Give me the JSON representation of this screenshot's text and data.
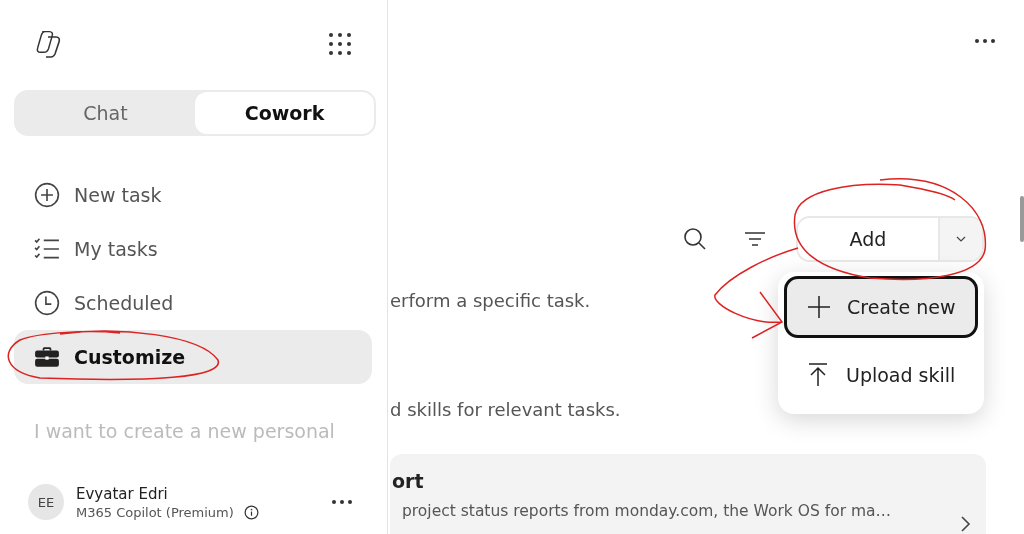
{
  "sidebar": {
    "tabs": [
      {
        "label": "Chat",
        "selected": false
      },
      {
        "label": "Cowork",
        "selected": true
      }
    ],
    "nav": [
      {
        "label": "New task",
        "kind": "plus-circle",
        "selected": false
      },
      {
        "label": "My tasks",
        "kind": "checklist",
        "selected": false
      },
      {
        "label": "Scheduled",
        "kind": "clock",
        "selected": false
      },
      {
        "label": "Customize",
        "kind": "briefcase",
        "selected": true
      }
    ],
    "prompt_text": "I want to create a new personal",
    "user": {
      "initials": "EE",
      "name": "Evyatar Edri",
      "plan": "M365 Copilot (Premium)"
    }
  },
  "main": {
    "add_button": {
      "label": "Add"
    },
    "menu": [
      {
        "label": "Create new",
        "kind": "plus",
        "selected": true
      },
      {
        "label": "Upload skill",
        "kind": "upload",
        "selected": false
      }
    ],
    "texts": [
      "erform a specific task.",
      "d skills for relevant tasks."
    ],
    "card": {
      "title": "ort",
      "description": "project status reports from monday.com, the Work OS for ma…"
    }
  }
}
